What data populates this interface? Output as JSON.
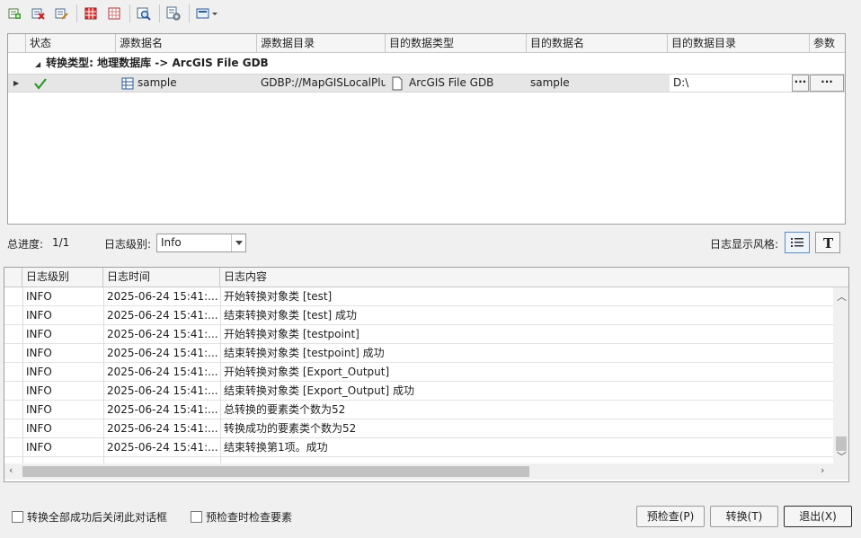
{
  "toolbar": {
    "buttons": [
      "add-icon",
      "delete-icon",
      "edit-list-icon",
      "select-all-icon",
      "deselect-icon",
      "zoom-icon",
      "settings-icon",
      "output-icon"
    ]
  },
  "task_grid": {
    "columns": [
      "状态",
      "源数据名",
      "源数据目录",
      "目的数据类型",
      "目的数据名",
      "目的数据目录",
      "参数"
    ],
    "group_label": "转换类型: 地理数据库 -> ArcGIS File GDB",
    "row": {
      "source_name": "sample",
      "source_dir": "GDBP://MapGISLocalPlus",
      "dest_type": "ArcGIS File GDB",
      "dest_name": "sample",
      "dest_dir": "D:\\",
      "ellipsis1": "···",
      "ellipsis2": "···"
    }
  },
  "progress": {
    "label": "总进度:",
    "value": "1/1",
    "level_label": "日志级别:",
    "level_value": "Info",
    "style_label": "日志显示风格:"
  },
  "log": {
    "columns": [
      "日志级别",
      "日志时间",
      "日志内容"
    ],
    "rows": [
      [
        "INFO",
        "2025-06-24 15:41:...",
        "开始转换对象类 [test]"
      ],
      [
        "INFO",
        "2025-06-24 15:41:...",
        "结束转换对象类 [test] 成功"
      ],
      [
        "INFO",
        "2025-06-24 15:41:...",
        "开始转换对象类 [testpoint]"
      ],
      [
        "INFO",
        "2025-06-24 15:41:...",
        "结束转换对象类 [testpoint] 成功"
      ],
      [
        "INFO",
        "2025-06-24 15:41:...",
        "开始转换对象类 [Export_Output]"
      ],
      [
        "INFO",
        "2025-06-24 15:41:...",
        "结束转换对象类 [Export_Output] 成功"
      ],
      [
        "INFO",
        "2025-06-24 15:41:...",
        "总转换的要素类个数为52"
      ],
      [
        "INFO",
        "2025-06-24 15:41:...",
        "转换成功的要素类个数为52"
      ],
      [
        "INFO",
        "2025-06-24 15:41:...",
        "结束转换第1项。成功"
      ]
    ]
  },
  "footer": {
    "close_after_label": "转换全部成功后关闭此对话框",
    "precheck_features_label": "预检查时检查要素",
    "precheck_button": "预检查(P)",
    "convert_button": "转换(T)",
    "exit_button": "退出(X)"
  }
}
